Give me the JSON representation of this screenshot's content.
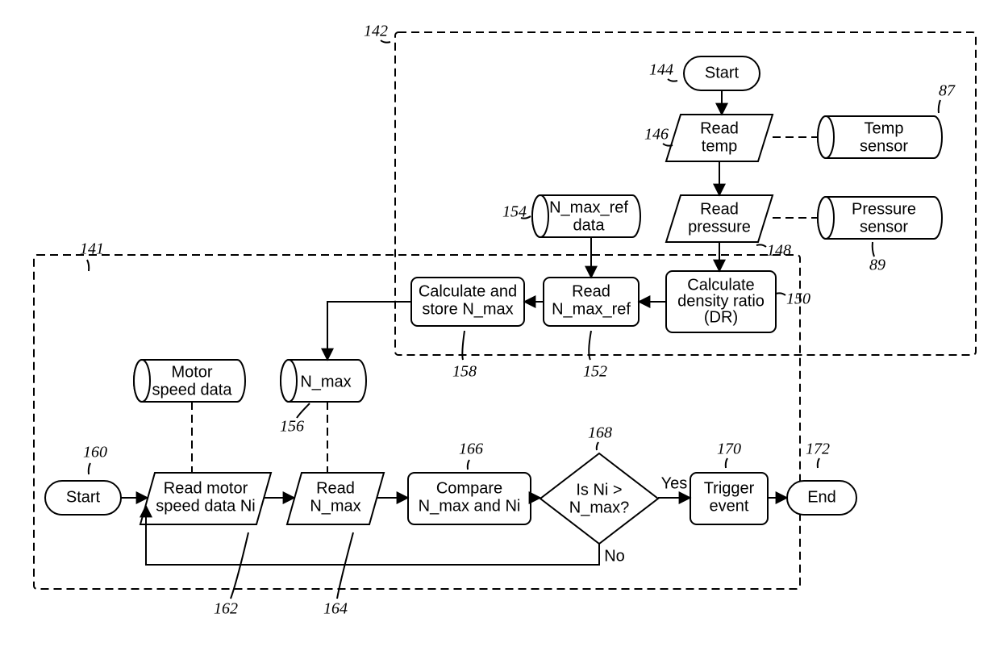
{
  "nodes": {
    "start142": "Start",
    "readTemp1": "Read",
    "readTemp2": "temp",
    "readPres1": "Read",
    "readPres2": "pressure",
    "tempSens1": "Temp",
    "tempSens2": "sensor",
    "presSens1": "Pressure",
    "presSens2": "sensor",
    "nmaxRef1": "N_max_ref",
    "nmaxRef2": "data",
    "calcDR1": "Calculate",
    "calcDR2": "density ratio",
    "calcDR3": "(DR)",
    "readNref1": "Read",
    "readNref2": "N_max_ref",
    "calcStore1": "Calculate and",
    "calcStore2": "store N_max",
    "nmax": "N_max",
    "motor1": "Motor",
    "motor2": "speed data",
    "start141": "Start",
    "readMotor1": "Read motor",
    "readMotor2": "speed data Ni",
    "readNmax1": "Read",
    "readNmax2": "N_max",
    "compare1": "Compare",
    "compare2": "N_max and Ni",
    "decision1": "Is Ni >",
    "decision2": "N_max?",
    "trigger1": "Trigger",
    "trigger2": "event",
    "end": "End"
  },
  "edges": {
    "yes": "Yes",
    "no": "No"
  },
  "refs": {
    "r142": "142",
    "r144": "144",
    "r146": "146",
    "r148": "148",
    "r150": "150",
    "r152": "152",
    "r154": "154",
    "r156": "156",
    "r158": "158",
    "r87": "87",
    "r89": "89",
    "r141": "141",
    "r160": "160",
    "r162": "162",
    "r164": "164",
    "r166": "166",
    "r168": "168",
    "r170": "170",
    "r172": "172"
  }
}
